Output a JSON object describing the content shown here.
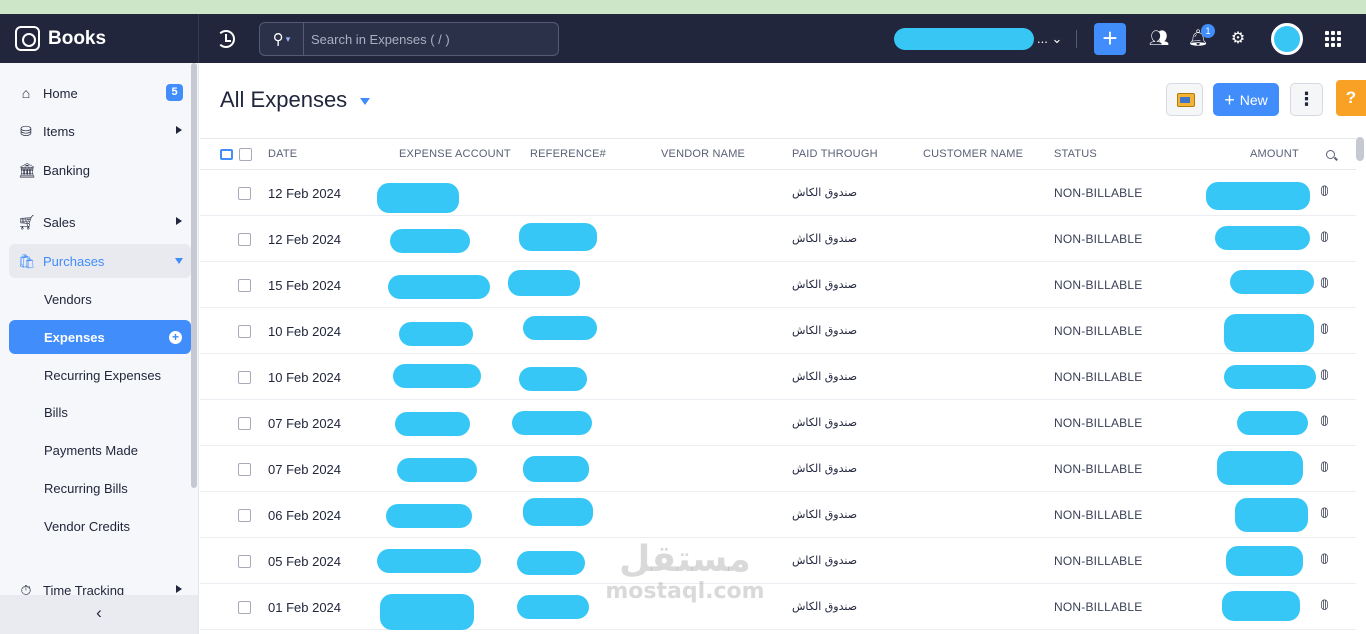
{
  "app": {
    "name": "Books"
  },
  "search": {
    "placeholder": "Search in Expenses ( / )"
  },
  "header": {
    "org_suffix": "...",
    "notification_count": "1",
    "colors": {
      "accent": "#408dfb",
      "topbar": "#21263c",
      "redaction": "#36c7f6",
      "help": "#f9a125"
    }
  },
  "sidebar": {
    "home": {
      "label": "Home",
      "badge": "5"
    },
    "items": {
      "label": "Items"
    },
    "banking": {
      "label": "Banking"
    },
    "sales": {
      "label": "Sales"
    },
    "purchases": {
      "label": "Purchases"
    },
    "purchases_sub": [
      "Vendors",
      "Expenses",
      "Recurring Expenses",
      "Bills",
      "Payments Made",
      "Recurring Bills",
      "Vendor Credits"
    ],
    "time_tracking": {
      "label": "Time Tracking"
    },
    "collapse": "‹"
  },
  "main": {
    "title": "All Expenses",
    "new_button": "New",
    "help": "?",
    "columns": {
      "date": "DATE",
      "expense_account": "EXPENSE ACCOUNT",
      "reference": "REFERENCE#",
      "vendor": "VENDOR NAME",
      "paid_through": "PAID THROUGH",
      "customer": "CUSTOMER NAME",
      "status": "STATUS",
      "amount": "AMOUNT"
    },
    "rows": [
      {
        "date": "12 Feb 2024",
        "paid_through": "صندوق الكاش",
        "status": "NON-BILLABLE"
      },
      {
        "date": "12 Feb 2024",
        "paid_through": "صندوق الكاش",
        "status": "NON-BILLABLE"
      },
      {
        "date": "15 Feb 2024",
        "paid_through": "صندوق الكاش",
        "status": "NON-BILLABLE"
      },
      {
        "date": "10 Feb 2024",
        "paid_through": "صندوق الكاش",
        "status": "NON-BILLABLE"
      },
      {
        "date": "10 Feb 2024",
        "paid_through": "صندوق الكاش",
        "status": "NON-BILLABLE"
      },
      {
        "date": "07 Feb 2024",
        "paid_through": "صندوق الكاش",
        "status": "NON-BILLABLE"
      },
      {
        "date": "07 Feb 2024",
        "paid_through": "صندوق الكاش",
        "status": "NON-BILLABLE"
      },
      {
        "date": "06 Feb 2024",
        "paid_through": "صندوق الكاش",
        "status": "NON-BILLABLE"
      },
      {
        "date": "05 Feb 2024",
        "paid_through": "صندوق الكاش",
        "status": "NON-BILLABLE"
      },
      {
        "date": "01 Feb 2024",
        "paid_through": "صندوق الكاش",
        "status": "NON-BILLABLE"
      }
    ]
  },
  "watermark": {
    "arabic": "مستقل",
    "latin": "mostaql.com"
  }
}
